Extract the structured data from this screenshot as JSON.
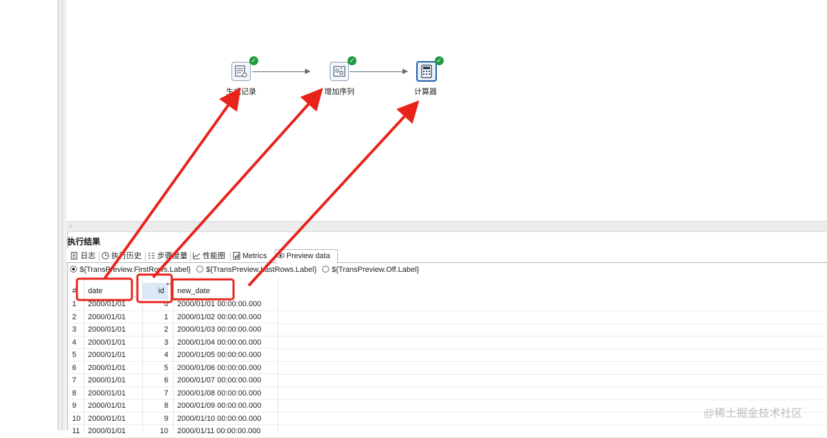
{
  "canvas": {
    "steps": [
      {
        "label": "生成记录",
        "icon": "generate-rows-icon",
        "status": "ok"
      },
      {
        "label": "增加序列",
        "icon": "add-sequence-icon",
        "status": "ok"
      },
      {
        "label": "计算器",
        "icon": "calculator-icon",
        "status": "ok",
        "selected": true
      }
    ]
  },
  "results": {
    "title": "执行结果",
    "tabs": [
      {
        "label": "日志",
        "icon": "log-icon"
      },
      {
        "label": "执行历史",
        "icon": "history-icon"
      },
      {
        "label": "步骤度量",
        "icon": "step-metrics-icon"
      },
      {
        "label": "性能图",
        "icon": "performance-graph-icon"
      },
      {
        "label": "Metrics",
        "icon": "metrics-icon"
      },
      {
        "label": "Preview data",
        "icon": "preview-eye-icon",
        "active": true
      }
    ],
    "preview_options": [
      {
        "label": "${TransPreview.FirstRows.Label}",
        "checked": true
      },
      {
        "label": "${TransPreview.LastRows.Label}",
        "checked": false
      },
      {
        "label": "${TransPreview.Off.Label}",
        "checked": false
      }
    ],
    "table": {
      "columns": [
        "#",
        "date",
        "id",
        "new_date"
      ],
      "rows": [
        [
          "1",
          "2000/01/01",
          "0",
          "2000/01/01 00:00:00.000"
        ],
        [
          "2",
          "2000/01/01",
          "1",
          "2000/01/02 00:00:00.000"
        ],
        [
          "3",
          "2000/01/01",
          "2",
          "2000/01/03 00:00:00.000"
        ],
        [
          "4",
          "2000/01/01",
          "3",
          "2000/01/04 00:00:00.000"
        ],
        [
          "5",
          "2000/01/01",
          "4",
          "2000/01/05 00:00:00.000"
        ],
        [
          "6",
          "2000/01/01",
          "5",
          "2000/01/06 00:00:00.000"
        ],
        [
          "7",
          "2000/01/01",
          "6",
          "2000/01/07 00:00:00.000"
        ],
        [
          "8",
          "2000/01/01",
          "7",
          "2000/01/08 00:00:00.000"
        ],
        [
          "9",
          "2000/01/01",
          "8",
          "2000/01/09 00:00:00.000"
        ],
        [
          "10",
          "2000/01/01",
          "9",
          "2000/01/10 00:00:00.000"
        ],
        [
          "11",
          "2000/01/01",
          "10",
          "2000/01/11 00:00:00.000"
        ]
      ]
    }
  },
  "annotation": {
    "color": "#e8231b"
  },
  "colors": {
    "ok": "#1f9a3c",
    "selected": "#1e5fa8"
  },
  "watermark": "@稀土掘金技术社区"
}
